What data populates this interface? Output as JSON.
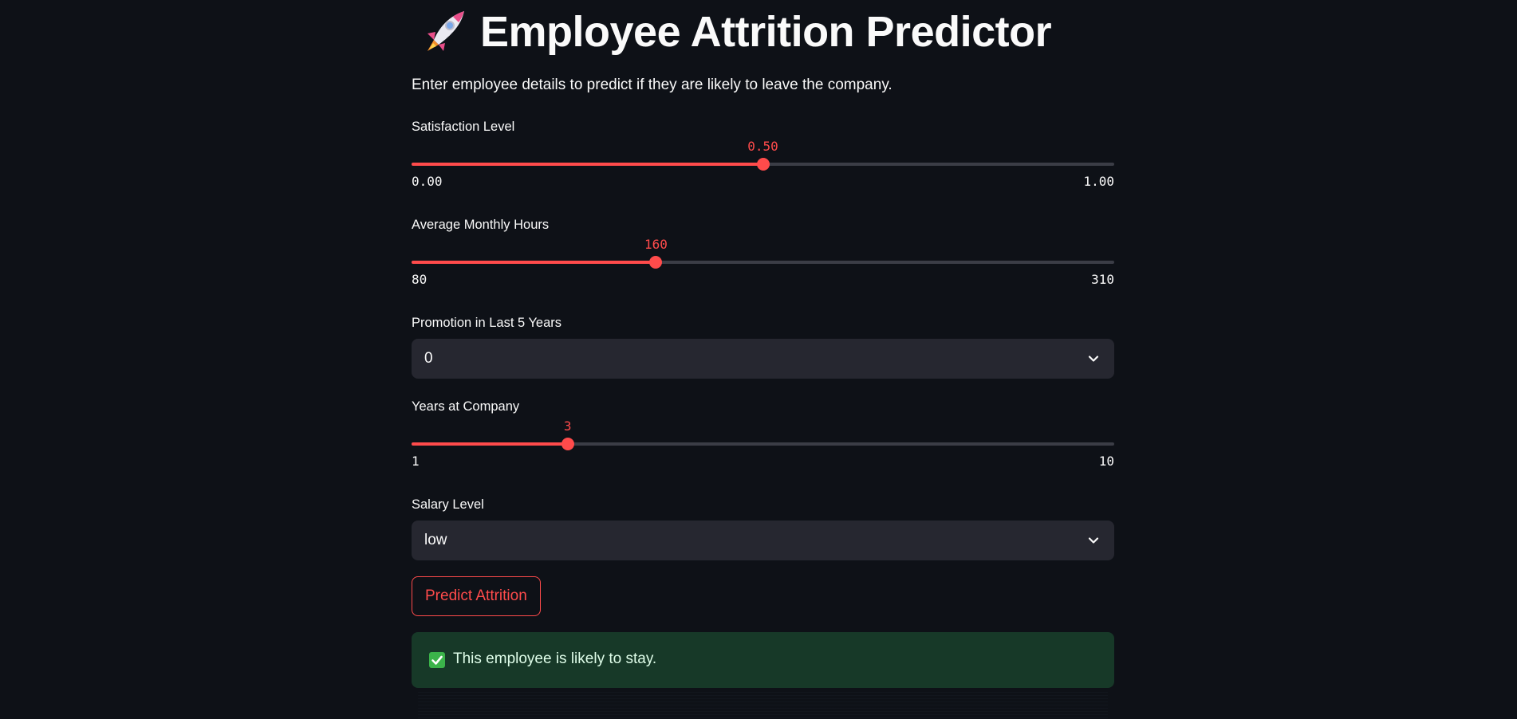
{
  "header": {
    "icon": "rocket-icon",
    "title": "Employee Attrition Predictor",
    "subtitle": "Enter employee details to predict if they are likely to leave the company."
  },
  "colors": {
    "background": "#0e1117",
    "accent": "#ff4b4b",
    "input_bg": "#262730",
    "success_bg": "#173928"
  },
  "satisfaction": {
    "label": "Satisfaction Level",
    "value": "0.50",
    "min": "0.00",
    "max": "1.00",
    "fraction": 0.5
  },
  "hours": {
    "label": "Average Monthly Hours",
    "value": "160",
    "min": "80",
    "max": "310",
    "fraction": 0.3478
  },
  "promotion": {
    "label": "Promotion in Last 5 Years",
    "selected": "0"
  },
  "years": {
    "label": "Years at Company",
    "value": "3",
    "min": "1",
    "max": "10",
    "fraction": 0.2222
  },
  "salary": {
    "label": "Salary Level",
    "selected": "low"
  },
  "predict_button": {
    "label": "Predict Attrition"
  },
  "result": {
    "icon": "check-box-icon",
    "text": "This employee is likely to stay."
  }
}
